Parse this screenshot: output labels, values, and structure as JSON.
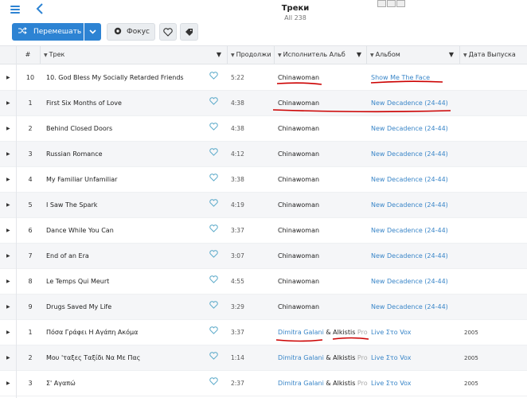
{
  "header": {
    "title": "Треки",
    "subtitle": "All 238"
  },
  "toolbar": {
    "shuffle_label": "Перемешать",
    "focus_label": "Фокус"
  },
  "columns": {
    "number": "#",
    "track": "Трек",
    "duration": "Продолжи",
    "artist": "Исполнитель Альб",
    "album": "Альбом",
    "release": "Дата Выпуска"
  },
  "rows": [
    {
      "num": "10",
      "track": "10. God Bless My Socially Retarded Friends",
      "duration": "5:22",
      "artist": "Chinawoman",
      "album": "Show Me The Face",
      "year": ""
    },
    {
      "num": "1",
      "track": "First Six Months of Love",
      "duration": "4:38",
      "artist": "Chinawoman",
      "album": "New Decadence (24-44)",
      "year": ""
    },
    {
      "num": "2",
      "track": "Behind Closed Doors",
      "duration": "4:38",
      "artist": "Chinawoman",
      "album": "New Decadence (24-44)",
      "year": ""
    },
    {
      "num": "3",
      "track": "Russian Romance",
      "duration": "4:12",
      "artist": "Chinawoman",
      "album": "New Decadence (24-44)",
      "year": ""
    },
    {
      "num": "4",
      "track": "My Familiar Unfamiliar",
      "duration": "3:38",
      "artist": "Chinawoman",
      "album": "New Decadence (24-44)",
      "year": ""
    },
    {
      "num": "5",
      "track": "I Saw The Spark",
      "duration": "4:19",
      "artist": "Chinawoman",
      "album": "New Decadence (24-44)",
      "year": ""
    },
    {
      "num": "6",
      "track": "Dance While You Can",
      "duration": "3:37",
      "artist": "Chinawoman",
      "album": "New Decadence (24-44)",
      "year": ""
    },
    {
      "num": "7",
      "track": "End of an Era",
      "duration": "3:07",
      "artist": "Chinawoman",
      "album": "New Decadence (24-44)",
      "year": ""
    },
    {
      "num": "8",
      "track": "Le Temps Qui Meurt",
      "duration": "4:55",
      "artist": "Chinawoman",
      "album": "New Decadence (24-44)",
      "year": ""
    },
    {
      "num": "9",
      "track": "Drugs Saved My Life",
      "duration": "3:29",
      "artist": "Chinawoman",
      "album": "New Decadence (24-44)",
      "year": ""
    },
    {
      "num": "1",
      "track": "Πόσα Γράφει Η Αγάπη Ακόμα",
      "duration": "3:37",
      "artist": "Dimitra Galani",
      "artist2": "Alkistis",
      "artist2_tail": "Pro",
      "album": "Live Στο Vox",
      "year": "2005"
    },
    {
      "num": "2",
      "track": "Μου 'ταξες Ταξίδι Να Με Πας",
      "duration": "1:14",
      "artist": "Dimitra Galani",
      "artist2": "Alkistis",
      "artist2_tail": "Pro",
      "album": "Live Στο Vox",
      "year": "2005"
    },
    {
      "num": "3",
      "track": "Σ' Αγαπώ",
      "duration": "2:37",
      "artist": "Dimitra Galani",
      "artist2": "Alkistis",
      "artist2_tail": "Pro",
      "album": "Live Στο Vox",
      "year": "2005"
    }
  ],
  "colors": {
    "accent": "#2d83d3",
    "link": "#3a86c8",
    "annotation": "#cc0000"
  }
}
